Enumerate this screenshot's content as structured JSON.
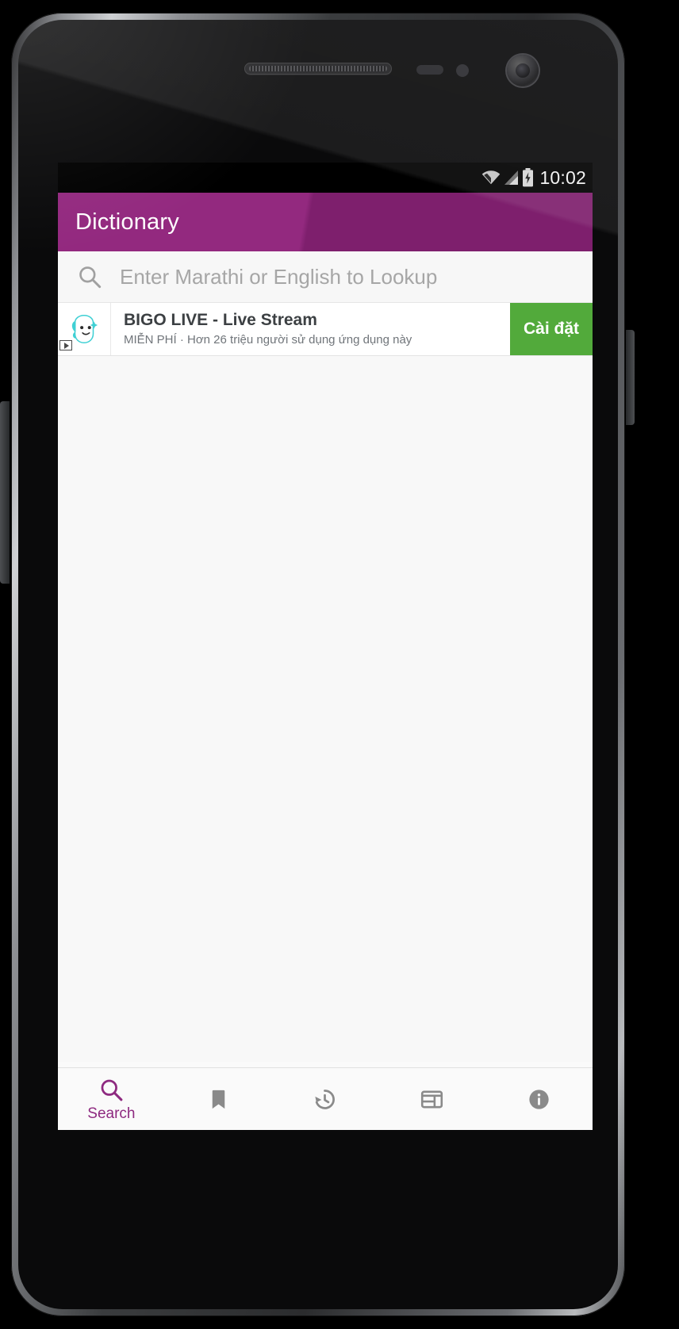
{
  "device": {
    "name": "android-phone-frame",
    "earpiece": "earpiece-grille",
    "front_camera": "front-camera"
  },
  "status_bar": {
    "time": "10:02",
    "icons": [
      "wifi-icon",
      "cellular-signal-icon",
      "battery-charging-icon"
    ],
    "background": "#000000",
    "text_color": "#f2f2f2"
  },
  "app_bar": {
    "title": "Dictionary",
    "background": "#8e2a80",
    "title_color": "#ffffff"
  },
  "search": {
    "icon": "search-icon",
    "placeholder": "Enter Marathi or English to Lookup",
    "value": "",
    "background": "#f7f7f7"
  },
  "ad": {
    "icon": "bigo-live-app-icon",
    "ad_choices_label": "ad-choices-icon",
    "title": "BIGO LIVE - Live Stream",
    "subtitle": "MIỄN PHÍ · Hơn 26 triệu người sử dụng ứng dụng này",
    "cta_label": "Cài đặt",
    "cta_color": "#52aa3b"
  },
  "content": {
    "background": "#f8f8f8",
    "items": []
  },
  "bottom_nav": {
    "active_color": "#8e2a80",
    "inactive_color": "#8a8a8a",
    "items": [
      {
        "id": "search",
        "icon": "search-icon",
        "label": "Search",
        "active": true
      },
      {
        "id": "bookmarks",
        "icon": "bookmark-icon",
        "label": "",
        "active": false
      },
      {
        "id": "history",
        "icon": "history-clock-icon",
        "label": "",
        "active": false
      },
      {
        "id": "wordofday",
        "icon": "card-layout-icon",
        "label": "",
        "active": false
      },
      {
        "id": "about",
        "icon": "info-icon",
        "label": "",
        "active": false
      }
    ]
  }
}
